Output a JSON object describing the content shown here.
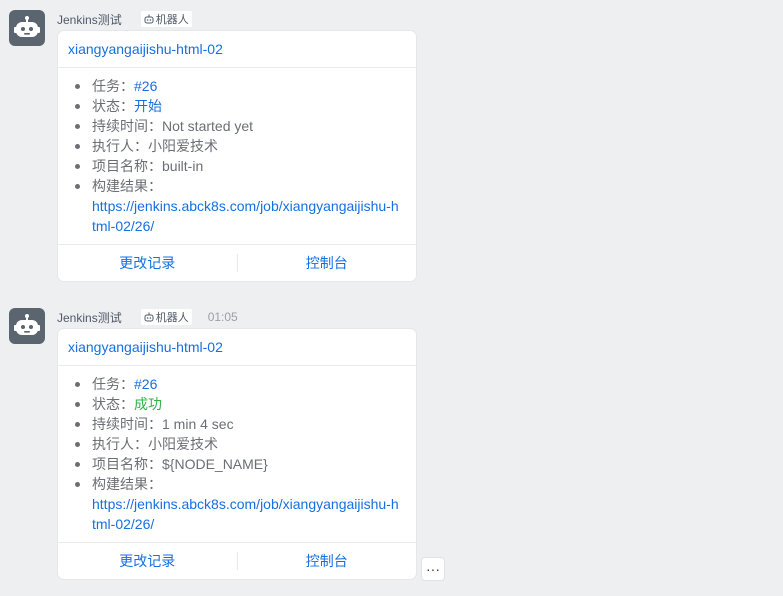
{
  "messages": [
    {
      "sender": "Jenkins测试",
      "bot_tag": "机器人",
      "time": "",
      "card": {
        "title": "xiangyangaijishu-html-02",
        "fields": [
          {
            "label": "任务：",
            "value": "#26"
          },
          {
            "label": "状态：",
            "value": "开始"
          },
          {
            "label": "持续时间：",
            "value": "Not started yet"
          },
          {
            "label": "执行人：",
            "value": "小阳爱技术"
          },
          {
            "label": "项目名称：",
            "value": "built-in"
          },
          {
            "label": "构建结果：",
            "value": "https://jenkins.abck8s.com/job/xiangyangaijishu-html-02/26/"
          }
        ],
        "actions": [
          "更改记录",
          "控制台"
        ]
      }
    },
    {
      "sender": "Jenkins测试",
      "bot_tag": "机器人",
      "time": "01:05",
      "card": {
        "title": "xiangyangaijishu-html-02",
        "fields": [
          {
            "label": "任务：",
            "value": "#26"
          },
          {
            "label": "状态：",
            "value": "成功"
          },
          {
            "label": "持续时间：",
            "value": "1 min 4 sec"
          },
          {
            "label": "执行人：",
            "value": "小阳爱技术"
          },
          {
            "label": "项目名称：",
            "value": "${NODE_NAME}"
          },
          {
            "label": "构建结果：",
            "value": "https://jenkins.abck8s.com/job/xiangyangaijishu-html-02/26/"
          }
        ],
        "actions": [
          "更改记录",
          "控制台"
        ]
      }
    }
  ],
  "more_button": "···",
  "colors": {
    "link": "#1670e0",
    "success": "#34b24c",
    "background": "#eeeff1",
    "avatar": "#5b6570"
  },
  "icons": {
    "avatar": "robot-icon",
    "bot_tag": "robot-small-icon"
  }
}
